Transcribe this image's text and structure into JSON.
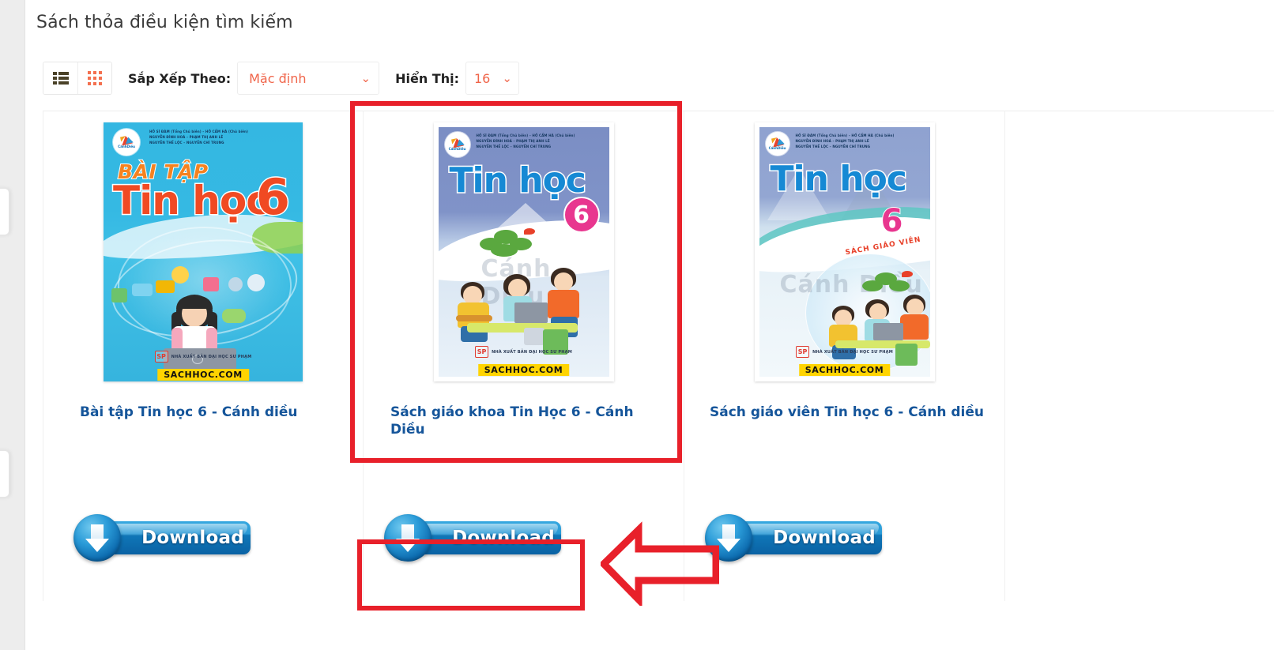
{
  "page": {
    "title": "Sách thỏa điều kiện tìm kiếm"
  },
  "toolbar": {
    "list_view_icon": "list-view-icon",
    "grid_view_icon": "grid-view-icon",
    "sort_label": "Sắp Xếp Theo:",
    "sort_value": "Mặc định",
    "show_label": "Hiển Thị:",
    "show_value": "16",
    "chevron": "⌄",
    "accent_color": "#f0654a",
    "label_color": "#222222"
  },
  "products": [
    {
      "title": "Bài tập Tin học 6 - Cánh diều",
      "cover": {
        "line1": "BÀI TẬP",
        "line2": "Tin học",
        "grade": "6",
        "authors": [
          "HỒ SĨ ĐÀM (Tổng Chủ biên) – HỒ CẨM HÀ (Chủ biên)",
          "NGUYỄN ĐÌNH HOÁ – PHẠM THỊ ANH LÊ",
          "NGUYỄN THẾ LỘC – NGUYỄN CHÍ TRUNG"
        ],
        "logo_text": "CánhDiều",
        "publisher_mark": "SP",
        "publisher": "NHÀ XUẤT BẢN ĐẠI HỌC SƯ PHẠM",
        "watermark_banner": "SACHHOC.COM"
      },
      "download_label": "Download"
    },
    {
      "title": "Sách giáo khoa Tin Học 6 - Cánh Diều",
      "cover": {
        "line2": "Tin học",
        "grade": "6",
        "authors": [
          "HỒ SĨ ĐÀM (Tổng Chủ biên) – HỒ CẨM HÀ (Chủ biên)",
          "NGUYỄN ĐÌNH HOÁ – PHẠM THỊ ANH LÊ",
          "NGUYỄN THẾ LỘC – NGUYỄN CHÍ TRUNG"
        ],
        "logo_text": "CánhDiều",
        "watermark": "Cánh Diều",
        "publisher_mark": "SP",
        "publisher": "NHÀ XUẤT BẢN ĐẠI HỌC SƯ PHẠM",
        "watermark_banner": "SACHHOC.COM"
      },
      "download_label": "Download"
    },
    {
      "title": "Sách giáo viên Tin học 6 - Cánh diều",
      "cover": {
        "line2": "Tin học",
        "grade": "6",
        "subtitle": "SÁCH GIÁO VIÊN",
        "authors": [
          "HỒ SĨ ĐÀM (Tổng Chủ biên) – HỒ CẨM HÀ (Chủ biên)",
          "NGUYỄN ĐÌNH HOÁ – PHẠM THỊ ANH LÊ",
          "NGUYỄN THẾ LỘC – NGUYỄN CHÍ TRUNG"
        ],
        "logo_text": "CánhDiều",
        "watermark": "Cánh Diều",
        "publisher_mark": "SP",
        "publisher": "NHÀ XUẤT BẢN ĐẠI HỌC SƯ PHẠM",
        "watermark_banner": "SACHHOC.COM"
      },
      "download_label": "Download"
    }
  ],
  "annotations": {
    "highlight_color": "#e8202a",
    "box_cover_name": "highlight-box-around-second-book",
    "box_download_name": "highlight-box-around-second-download",
    "arrow_name": "pointer-arrow-left"
  },
  "colors": {
    "title_link": "#15559a",
    "page_title": "#3b3b3b",
    "download_blue": "#1077b8",
    "banner_yellow": "#ffd400"
  }
}
